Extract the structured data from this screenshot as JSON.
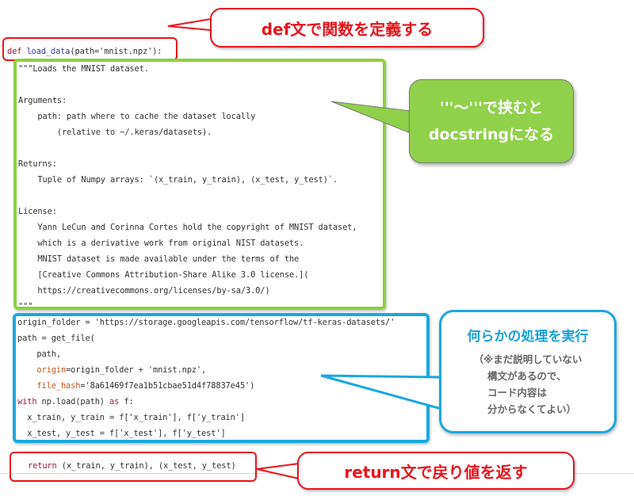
{
  "code": {
    "def_line": {
      "keyword": "def",
      "name": "load_data",
      "args": "(path='mnist.npz'):"
    },
    "docstring_lines": [
      "\"\"\"Loads the MNIST dataset.",
      "",
      "Arguments:",
      "    path: path where to cache the dataset locally",
      "        (relative to ~/.keras/datasets).",
      "",
      "Returns:",
      "    Tuple of Numpy arrays: `(x_train, y_train), (x_test, y_test)`.",
      "",
      "License:",
      "    Yann LeCun and Corinna Cortes hold the copyright of MNIST dataset,",
      "    which is a derivative work from original NIST datasets.",
      "    MNIST dataset is made available under the terms of the",
      "    [Creative Commons Attribution-Share Alike 3.0 license.](",
      "    https://creativecommons.org/licenses/by-sa/3.0/)",
      "\"\"\""
    ],
    "body": {
      "l1_var": "origin_folder = ",
      "l1_str": "'https://storage.googleapis.com/tensorflow/tf-keras-datasets/'",
      "l2": "path = get_file(",
      "l3": "    path,",
      "l4_kw": "    origin",
      "l4_rest": "=origin_folder + 'mnist.npz',",
      "l5_kw": "    file_hash",
      "l5_rest": "='8a61469f7ea1b51cbae51d4f78837e45')",
      "l6_with": "with",
      "l6_mid": " np.load(path) ",
      "l6_as": "as",
      "l6_end": " f:",
      "l7": "  x_train, y_train = f['x_train'], f['y_train']",
      "l8": "  x_test, y_test = f['x_test'], f['y_test']"
    },
    "return_line": {
      "keyword": "return",
      "rest": " (x_train, y_train), (x_test, y_test)"
    }
  },
  "callouts": {
    "def": "def文で関数を定義する",
    "docstring_line1": "'''～'''で挟むと",
    "docstring_line2": "docstringになる",
    "process_title": "何らかの処理を実行",
    "process_note": "（※まだ説明していない\n    構文があるので、\n    コード内容は\n    分からなくてよい）",
    "return": "return文で戻り値を返す"
  },
  "colors": {
    "red": "#e8141c",
    "green": "#8ccf3c",
    "blue": "#1aa8e0"
  }
}
